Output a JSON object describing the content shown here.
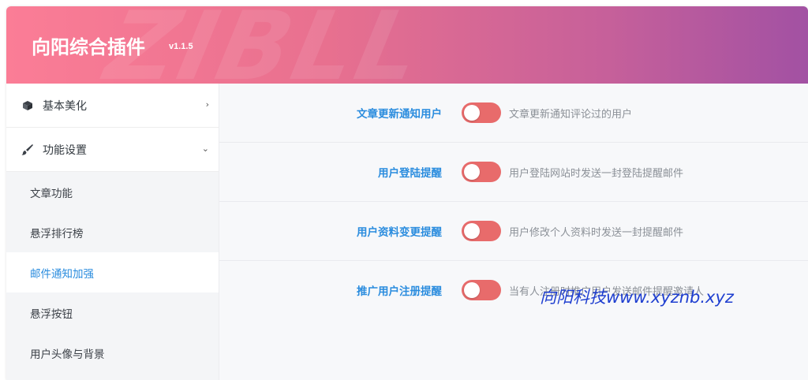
{
  "header": {
    "title": "向阳综合插件",
    "version": "v1.1.5",
    "watermark": "ZIBLL"
  },
  "sidebar": {
    "groups": [
      {
        "label": "基本美化",
        "icon": "cube-icon",
        "chevron": "›",
        "expanded": false
      },
      {
        "label": "功能设置",
        "icon": "brush-icon",
        "chevron": "⌄",
        "expanded": true
      }
    ],
    "sub_items": [
      {
        "label": "文章功能",
        "active": false
      },
      {
        "label": "悬浮排行榜",
        "active": false
      },
      {
        "label": "邮件通知加强",
        "active": true
      },
      {
        "label": "悬浮按钮",
        "active": false
      },
      {
        "label": "用户头像与背景",
        "active": false
      }
    ]
  },
  "settings": [
    {
      "label": "文章更新通知用户",
      "enabled": false,
      "description": "文章更新通知评论过的用户"
    },
    {
      "label": "用户登陆提醒",
      "enabled": false,
      "description": "用户登陆网站时发送一封登陆提醒邮件"
    },
    {
      "label": "用户资料变更提醒",
      "enabled": false,
      "description": "用户修改个人资料时发送一封提醒邮件"
    },
    {
      "label": "推广用户注册提醒",
      "enabled": false,
      "description": "当有人注册时推广用户发送邮件提醒邀请人"
    }
  ],
  "overlay": {
    "watermark": "向阳科技www.xyznb.xyz"
  },
  "colors": {
    "header_gradient_start": "#fb7d96",
    "header_gradient_end": "#a251a3",
    "accent_blue": "#2a8cde",
    "toggle_off": "#e86b6b",
    "overlay_blue": "#1f3fd0"
  }
}
